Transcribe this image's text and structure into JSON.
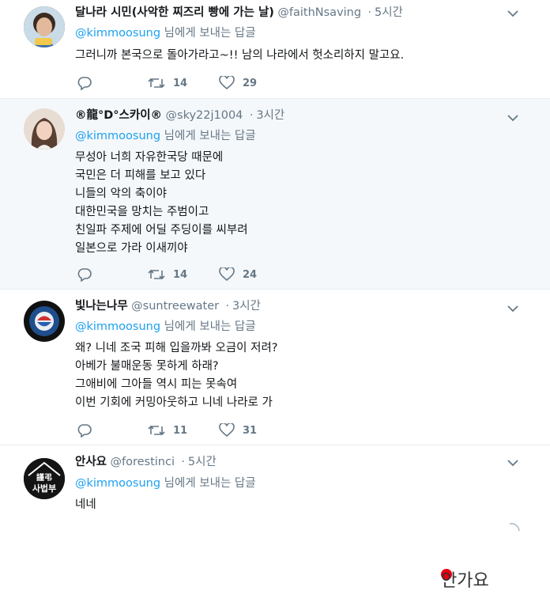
{
  "tweets": [
    {
      "name": "달나라 시민(사악한 찌즈리 빵에 가는 날)",
      "handle": "@faithNsaving",
      "dot": "·",
      "time": "5시간",
      "mention": "@kimmoosung",
      "reply_text": " 님에게 보내는 답글",
      "lines": [
        "그러니까 본국으로 돌아가라고~!! 남의 나라에서 헛소리하지 말고요."
      ],
      "retweets": "14",
      "likes": "29"
    },
    {
      "name": "®龍°D°스카이®",
      "handle": "@sky22j1004",
      "dot": "·",
      "time": "3시간",
      "mention": "@kimmoosung",
      "reply_text": " 님에게 보내는 답글",
      "lines": [
        "무성아 너희 자유한국당 때문에",
        "국민은 더 피해를 보고 있다",
        "니들의 악의 축이야",
        "대한민국을 망치는 주범이고",
        "친일파 주제에 어딜 주딩이를 씨부려",
        "일본으로 가라 이새끼야"
      ],
      "retweets": "14",
      "likes": "24"
    },
    {
      "name": "빛나는나무",
      "handle": "@suntreewater",
      "dot": "·",
      "time": "3시간",
      "mention": "@kimmoosung",
      "reply_text": " 님에게 보내는 답글",
      "lines": [
        "왜? 니네 조국 피해 입을까봐 오금이 저려?",
        "아베가 불매운동 못하게 하래?",
        "그애비에 그아들 역시 피는 못속여",
        "이번 기회에 커밍아웃하고 니네 나라로 가"
      ],
      "retweets": "11",
      "likes": "31"
    },
    {
      "name": "안사요",
      "handle": "@forestinci",
      "dot": "·",
      "time": "5시간",
      "mention": "@kimmoosung",
      "reply_text": " 님에게 보내는 답글",
      "lines": [
        "네네"
      ],
      "avatar_text_top": "謹弔",
      "avatar_text_bottom": "사법부"
    }
  ],
  "watermark": "안가요",
  "colors": {
    "link": "#1da1f2",
    "muted": "#657786",
    "alt_bg": "#f5f8fa",
    "border": "#e6ecf0",
    "watermark_dot": "#e60012"
  },
  "icons": [
    "reply-icon",
    "retweet-icon",
    "like-icon",
    "chevron-down-icon"
  ]
}
